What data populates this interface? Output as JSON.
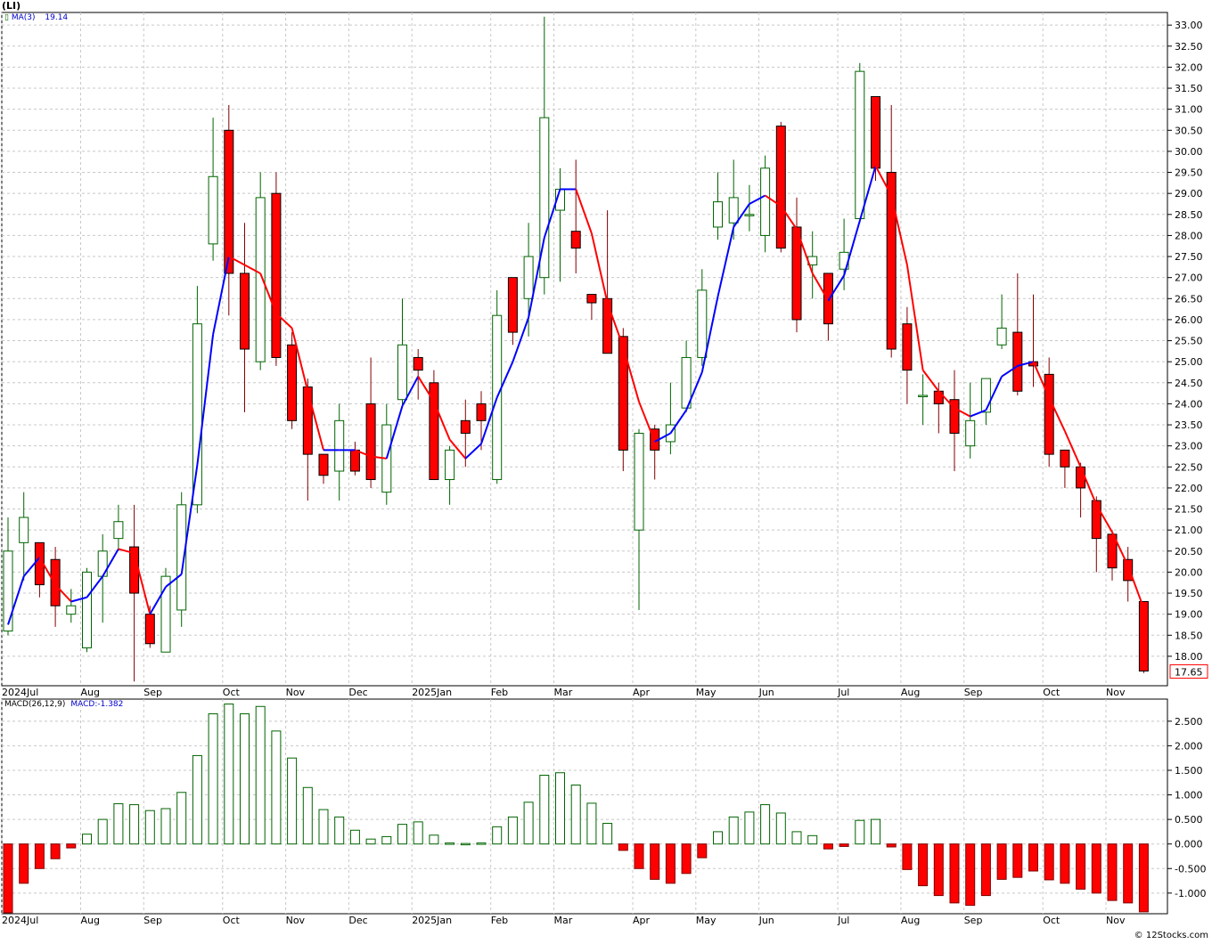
{
  "header": {
    "symbol": "(LI)"
  },
  "legend": {
    "ma_label": "MA(3)",
    "ma_value": "19.14",
    "macd_label": "MACD(26,12,9)",
    "macd_value": "MACD:-1.382"
  },
  "last_price_tag": "17.65",
  "footer": {
    "credit": "© 12Stocks.com"
  },
  "colors": {
    "up": "#006400",
    "down": "#ff0000",
    "ma_up": "#0000ff",
    "ma_down": "#ff0000",
    "grid": "#c8c8c8"
  },
  "chart_data": [
    {
      "type": "candlestick",
      "title": "(LI)",
      "ylim": [
        17.3,
        33.3
      ],
      "yticks": [
        "18.00",
        "18.50",
        "19.00",
        "19.50",
        "20.00",
        "20.50",
        "21.00",
        "21.50",
        "22.00",
        "22.50",
        "23.00",
        "23.50",
        "24.00",
        "24.50",
        "25.00",
        "25.50",
        "26.00",
        "26.50",
        "27.00",
        "27.50",
        "28.00",
        "28.50",
        "29.00",
        "29.50",
        "30.00",
        "30.50",
        "31.00",
        "31.50",
        "32.00",
        "32.50",
        "33.00"
      ],
      "xticks": [
        {
          "label": "2024Jul",
          "week": 0
        },
        {
          "label": "Aug",
          "week": 5
        },
        {
          "label": "Sep",
          "week": 9
        },
        {
          "label": "Oct",
          "week": 14
        },
        {
          "label": "Nov",
          "week": 18
        },
        {
          "label": "Dec",
          "week": 22
        },
        {
          "label": "2025Jan",
          "week": 26
        },
        {
          "label": "Feb",
          "week": 31
        },
        {
          "label": "Mar",
          "week": 35
        },
        {
          "label": "Apr",
          "week": 40
        },
        {
          "label": "May",
          "week": 44
        },
        {
          "label": "Jun",
          "week": 48
        },
        {
          "label": "Jul",
          "week": 53
        },
        {
          "label": "Aug",
          "week": 57
        },
        {
          "label": "Sep",
          "week": 61
        },
        {
          "label": "Oct",
          "week": 66
        },
        {
          "label": "Nov",
          "week": 70
        }
      ],
      "candles": [
        {
          "o": 18.6,
          "h": 21.3,
          "l": 18.5,
          "c": 20.5
        },
        {
          "o": 20.7,
          "h": 21.9,
          "l": 19.8,
          "c": 21.3
        },
        {
          "o": 20.7,
          "h": 20.7,
          "l": 19.4,
          "c": 19.7
        },
        {
          "o": 20.3,
          "h": 20.6,
          "l": 18.7,
          "c": 19.2
        },
        {
          "o": 19.0,
          "h": 19.6,
          "l": 18.8,
          "c": 19.2
        },
        {
          "o": 18.2,
          "h": 20.1,
          "l": 18.1,
          "c": 20.0
        },
        {
          "o": 19.9,
          "h": 20.9,
          "l": 18.8,
          "c": 20.5
        },
        {
          "o": 20.8,
          "h": 21.6,
          "l": 20.5,
          "c": 21.2
        },
        {
          "o": 20.6,
          "h": 21.6,
          "l": 17.4,
          "c": 19.5
        },
        {
          "o": 19.0,
          "h": 19.2,
          "l": 18.2,
          "c": 18.3
        },
        {
          "o": 18.1,
          "h": 20.1,
          "l": 18.1,
          "c": 19.9
        },
        {
          "o": 19.1,
          "h": 21.9,
          "l": 18.7,
          "c": 21.6
        },
        {
          "o": 21.6,
          "h": 26.8,
          "l": 21.4,
          "c": 25.9
        },
        {
          "o": 27.8,
          "h": 30.8,
          "l": 27.4,
          "c": 29.4
        },
        {
          "o": 30.5,
          "h": 31.1,
          "l": 26.1,
          "c": 27.1
        },
        {
          "o": 27.1,
          "h": 28.3,
          "l": 23.8,
          "c": 25.3
        },
        {
          "o": 25.0,
          "h": 29.5,
          "l": 24.8,
          "c": 28.9
        },
        {
          "o": 29.0,
          "h": 29.5,
          "l": 24.9,
          "c": 25.1
        },
        {
          "o": 25.4,
          "h": 25.7,
          "l": 23.4,
          "c": 23.6
        },
        {
          "o": 24.4,
          "h": 24.6,
          "l": 21.7,
          "c": 22.8
        },
        {
          "o": 22.8,
          "h": 22.8,
          "l": 22.1,
          "c": 22.3
        },
        {
          "o": 22.4,
          "h": 24.0,
          "l": 21.7,
          "c": 23.6
        },
        {
          "o": 22.9,
          "h": 23.1,
          "l": 22.3,
          "c": 22.4
        },
        {
          "o": 24.0,
          "h": 25.1,
          "l": 22.0,
          "c": 22.2
        },
        {
          "o": 21.9,
          "h": 24.0,
          "l": 21.6,
          "c": 23.5
        },
        {
          "o": 24.1,
          "h": 26.5,
          "l": 23.9,
          "c": 25.4
        },
        {
          "o": 25.1,
          "h": 25.3,
          "l": 24.1,
          "c": 24.8
        },
        {
          "o": 24.5,
          "h": 24.8,
          "l": 22.2,
          "c": 22.2
        },
        {
          "o": 22.2,
          "h": 23.0,
          "l": 21.6,
          "c": 22.9
        },
        {
          "o": 23.6,
          "h": 24.1,
          "l": 22.5,
          "c": 23.3
        },
        {
          "o": 24.0,
          "h": 24.3,
          "l": 22.9,
          "c": 23.6
        },
        {
          "o": 22.2,
          "h": 26.7,
          "l": 22.1,
          "c": 26.1
        },
        {
          "o": 27.0,
          "h": 27.0,
          "l": 25.4,
          "c": 25.7
        },
        {
          "o": 26.5,
          "h": 28.3,
          "l": 25.6,
          "c": 27.5
        },
        {
          "o": 27.0,
          "h": 33.2,
          "l": 26.6,
          "c": 30.8
        },
        {
          "o": 28.6,
          "h": 29.6,
          "l": 26.9,
          "c": 29.1
        },
        {
          "o": 28.1,
          "h": 29.8,
          "l": 27.1,
          "c": 27.7
        },
        {
          "o": 26.6,
          "h": 26.6,
          "l": 26.0,
          "c": 26.4
        },
        {
          "o": 26.5,
          "h": 28.6,
          "l": 25.3,
          "c": 25.2
        },
        {
          "o": 25.6,
          "h": 25.8,
          "l": 22.4,
          "c": 22.9
        },
        {
          "o": 21.0,
          "h": 23.4,
          "l": 19.1,
          "c": 23.3
        },
        {
          "o": 23.4,
          "h": 23.5,
          "l": 22.2,
          "c": 22.9
        },
        {
          "o": 23.1,
          "h": 24.5,
          "l": 22.8,
          "c": 23.5
        },
        {
          "o": 23.9,
          "h": 25.5,
          "l": 23.8,
          "c": 25.1
        },
        {
          "o": 25.1,
          "h": 27.2,
          "l": 24.9,
          "c": 26.7
        },
        {
          "o": 28.2,
          "h": 29.5,
          "l": 27.9,
          "c": 28.8
        },
        {
          "o": 28.3,
          "h": 29.8,
          "l": 27.9,
          "c": 28.9
        },
        {
          "o": 28.5,
          "h": 29.2,
          "l": 28.1,
          "c": 28.5
        },
        {
          "o": 28.0,
          "h": 29.9,
          "l": 27.6,
          "c": 29.6
        },
        {
          "o": 30.6,
          "h": 30.7,
          "l": 27.6,
          "c": 27.7
        },
        {
          "o": 28.2,
          "h": 28.9,
          "l": 25.7,
          "c": 26.0
        },
        {
          "o": 27.3,
          "h": 28.1,
          "l": 26.5,
          "c": 27.5
        },
        {
          "o": 27.1,
          "h": 27.1,
          "l": 25.5,
          "c": 25.9
        },
        {
          "o": 27.2,
          "h": 28.4,
          "l": 26.7,
          "c": 27.6
        },
        {
          "o": 28.4,
          "h": 32.1,
          "l": 28.3,
          "c": 31.9
        },
        {
          "o": 31.3,
          "h": 31.3,
          "l": 29.3,
          "c": 29.6
        },
        {
          "o": 29.5,
          "h": 31.1,
          "l": 25.1,
          "c": 25.3
        },
        {
          "o": 25.9,
          "h": 26.3,
          "l": 24.0,
          "c": 24.8
        },
        {
          "o": 24.2,
          "h": 24.7,
          "l": 23.5,
          "c": 24.2
        },
        {
          "o": 24.3,
          "h": 24.5,
          "l": 23.3,
          "c": 24.0
        },
        {
          "o": 24.1,
          "h": 24.8,
          "l": 22.4,
          "c": 23.3
        },
        {
          "o": 23.0,
          "h": 24.5,
          "l": 22.7,
          "c": 23.6
        },
        {
          "o": 23.8,
          "h": 24.6,
          "l": 23.5,
          "c": 24.6
        },
        {
          "o": 25.4,
          "h": 26.6,
          "l": 25.3,
          "c": 25.8
        },
        {
          "o": 25.7,
          "h": 27.1,
          "l": 24.2,
          "c": 24.3
        },
        {
          "o": 25.0,
          "h": 26.6,
          "l": 24.4,
          "c": 24.9
        },
        {
          "o": 24.7,
          "h": 25.1,
          "l": 22.5,
          "c": 22.8
        },
        {
          "o": 22.9,
          "h": 22.9,
          "l": 22.0,
          "c": 22.5
        },
        {
          "o": 22.5,
          "h": 22.6,
          "l": 21.3,
          "c": 22.0
        },
        {
          "o": 21.7,
          "h": 21.8,
          "l": 20.0,
          "c": 20.8
        },
        {
          "o": 20.9,
          "h": 21.0,
          "l": 19.8,
          "c": 20.1
        },
        {
          "o": 20.3,
          "h": 20.6,
          "l": 19.3,
          "c": 19.8
        },
        {
          "o": 19.3,
          "h": 19.3,
          "l": 17.6,
          "c": 17.65
        }
      ],
      "ma": {
        "name": "MA(3)",
        "values": [
          18.75,
          19.9,
          20.35,
          19.7,
          19.3,
          19.4,
          19.9,
          20.55,
          20.45,
          19.0,
          19.65,
          19.95,
          22.55,
          25.65,
          27.5,
          27.3,
          27.1,
          26.15,
          25.8,
          24.3,
          22.9,
          22.9,
          22.9,
          22.75,
          22.7,
          23.95,
          24.65,
          24.05,
          23.15,
          22.7,
          23.05,
          24.15,
          25.0,
          26.05,
          27.95,
          29.1,
          29.1,
          28.05,
          26.4,
          25.35,
          24.05,
          23.1,
          23.3,
          23.85,
          24.75,
          26.55,
          28.2,
          28.75,
          28.95,
          28.7,
          28.15,
          27.1,
          26.45,
          27.05,
          28.35,
          29.65,
          28.95,
          27.3,
          24.8,
          24.3,
          23.9,
          23.7,
          23.85,
          24.65,
          24.9,
          25.0,
          24.15,
          23.35,
          22.5,
          21.6,
          20.95,
          20.15,
          19.14
        ]
      }
    },
    {
      "type": "bar",
      "title": "MACD(26,12,9)",
      "ylim": [
        -1.42,
        2.95
      ],
      "yticks": [
        "-1.000",
        "-0.500",
        "0.000",
        "0.500",
        "1.000",
        "1.500",
        "2.000",
        "2.500"
      ],
      "values": [
        -1.4,
        -0.8,
        -0.5,
        -0.3,
        -0.08,
        0.2,
        0.5,
        0.82,
        0.8,
        0.68,
        0.72,
        1.05,
        1.8,
        2.65,
        2.85,
        2.65,
        2.8,
        2.3,
        1.75,
        1.15,
        0.7,
        0.55,
        0.28,
        0.1,
        0.15,
        0.4,
        0.45,
        0.18,
        0.02,
        0.01,
        0.02,
        0.35,
        0.55,
        0.85,
        1.4,
        1.45,
        1.2,
        0.83,
        0.42,
        -0.13,
        -0.5,
        -0.72,
        -0.8,
        -0.6,
        -0.28,
        0.25,
        0.55,
        0.65,
        0.8,
        0.63,
        0.25,
        0.17,
        -0.1,
        -0.05,
        0.48,
        0.5,
        -0.06,
        -0.52,
        -0.85,
        -1.05,
        -1.2,
        -1.25,
        -1.05,
        -0.72,
        -0.68,
        -0.55,
        -0.73,
        -0.8,
        -0.92,
        -1.0,
        -1.15,
        -1.2,
        -1.382
      ]
    }
  ]
}
